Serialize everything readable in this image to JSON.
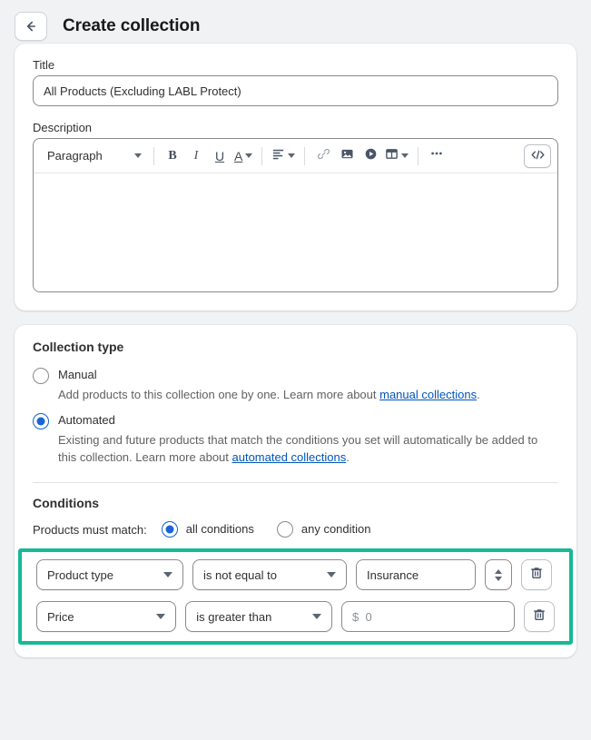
{
  "header": {
    "back_icon": "arrow-left-icon",
    "title": "Create collection"
  },
  "title_field": {
    "label": "Title",
    "value": "All Products (Excluding LABL Protect)",
    "placeholder": ""
  },
  "description_field": {
    "label": "Description",
    "body_value": "",
    "body_placeholder": "",
    "toolbar": {
      "block_style": "Paragraph",
      "bold_label": "B",
      "italic_label": "I",
      "underline_label": "U",
      "text_color_label": "A",
      "buttons": [
        "paragraph-style-select",
        "bold-button",
        "italic-button",
        "underline-button",
        "text-color-button",
        "align-button",
        "link-button",
        "image-button",
        "video-button",
        "table-button",
        "more-options-button",
        "code-view-button"
      ]
    }
  },
  "collection_type": {
    "section_title": "Collection type",
    "options": [
      {
        "label": "Manual",
        "selected": false,
        "help_before": "Add products to this collection one by one. Learn more about ",
        "help_link": "manual collections",
        "help_after": "."
      },
      {
        "label": "Automated",
        "selected": true,
        "help_before": "Existing and future products that match the conditions you set will automatically be added to this collection. Learn more about ",
        "help_link": "automated collections",
        "help_after": "."
      }
    ]
  },
  "conditions": {
    "section_title": "Conditions",
    "match_label": "Products must match:",
    "match_options": [
      {
        "label": "all conditions",
        "selected": true
      },
      {
        "label": "any condition",
        "selected": false
      }
    ],
    "rows": [
      {
        "field": "Product type",
        "relation": "is not equal to",
        "value": "Insurance",
        "value_placeholder": "",
        "has_stepper": true,
        "delete_label": "Remove condition"
      },
      {
        "field": "Price",
        "relation": "is greater than",
        "value": "",
        "value_placeholder": "$  0",
        "has_stepper": false,
        "delete_label": "Remove condition"
      }
    ]
  },
  "colors": {
    "page_bg": "#f1f2f4",
    "card_bg": "#ffffff",
    "accent_radio": "#1a64d4",
    "link": "#0055b8",
    "highlight_border": "#17b897",
    "text_primary": "#303030",
    "text_subdued": "#616161"
  }
}
